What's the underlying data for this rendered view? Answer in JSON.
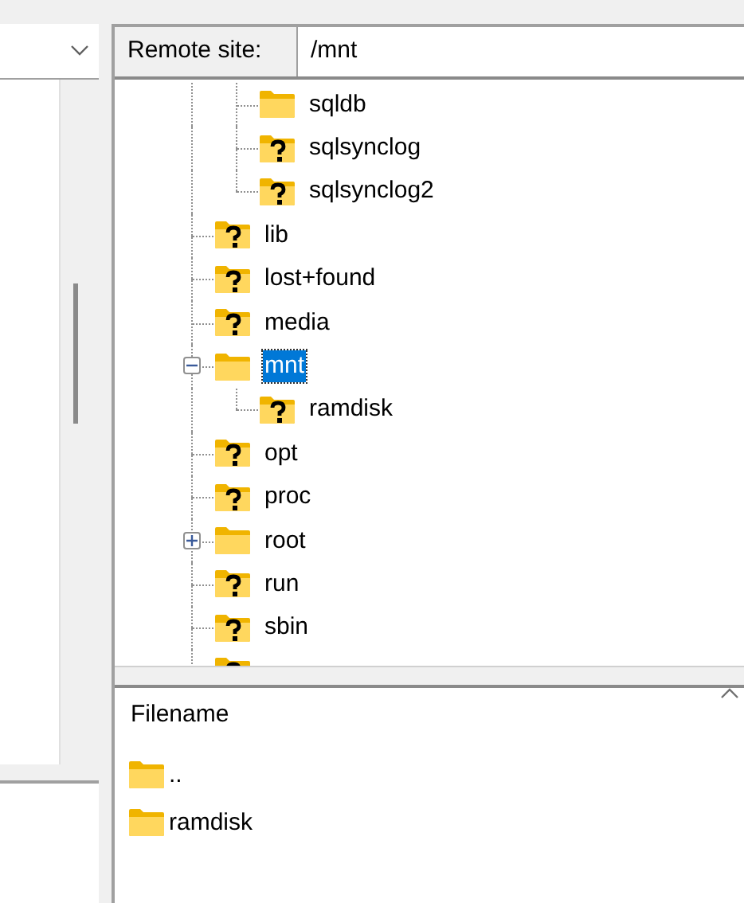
{
  "remote_site": {
    "label": "Remote site:",
    "path": "/mnt"
  },
  "tree": {
    "items": [
      {
        "kind": "hidden_parent",
        "children": [
          {
            "kind": "folder",
            "label": "sqldb",
            "selected": false
          },
          {
            "kind": "unknown",
            "label": "sqlsynclog",
            "selected": false
          },
          {
            "kind": "unknown",
            "label": "sqlsynclog2",
            "selected": false
          }
        ]
      },
      {
        "kind": "unknown",
        "label": "lib",
        "selected": false
      },
      {
        "kind": "unknown",
        "label": "lost+found",
        "selected": false
      },
      {
        "kind": "unknown",
        "label": "media",
        "selected": false
      },
      {
        "kind": "folder",
        "label": "mnt",
        "selected": true,
        "expanded": true,
        "children": [
          {
            "kind": "unknown",
            "label": "ramdisk",
            "selected": false
          }
        ]
      },
      {
        "kind": "unknown",
        "label": "opt",
        "selected": false
      },
      {
        "kind": "unknown",
        "label": "proc",
        "selected": false
      },
      {
        "kind": "folder",
        "label": "root",
        "selected": false,
        "expanded": false
      },
      {
        "kind": "unknown",
        "label": "run",
        "selected": false
      },
      {
        "kind": "unknown",
        "label": "sbin",
        "selected": false
      },
      {
        "kind": "unknown"
      }
    ]
  },
  "file_list": {
    "columns": [
      "Filename"
    ],
    "rows": [
      {
        "name": ".."
      },
      {
        "name": "ramdisk"
      }
    ]
  }
}
